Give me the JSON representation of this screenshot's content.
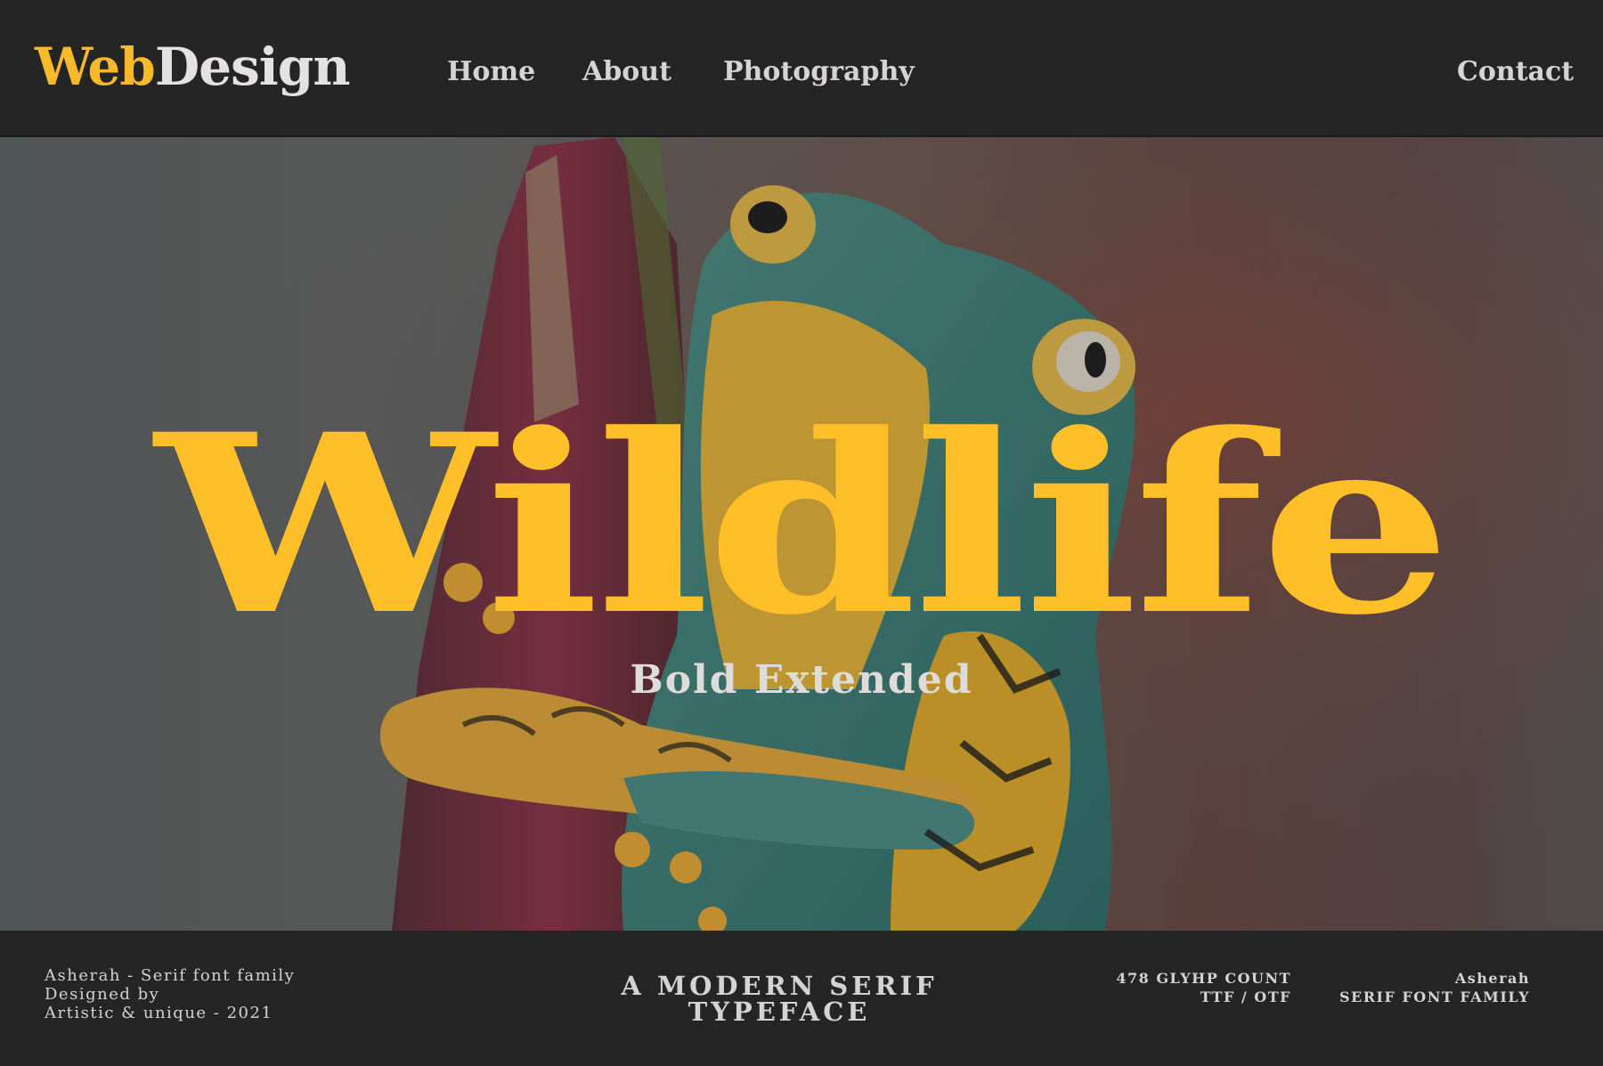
{
  "header": {
    "logo": {
      "part1": "Web",
      "part2": "Design"
    },
    "nav": {
      "home": "Home",
      "about": "About",
      "photography": "Photography",
      "contact": "Contact"
    }
  },
  "hero": {
    "title": "Wildlife",
    "subtitle": "Bold Extended",
    "background": "frog-on-flower-photo"
  },
  "footer": {
    "credits": {
      "line1": "Asherah - Serif font family",
      "line2": "Designed by",
      "line3": "Artistic & unique - 2021"
    },
    "tagline": "A MODERN SERIF TYPEFACE",
    "specs": {
      "glyphs": "478 GLYHP COUNT",
      "formats": "TTF / OTF"
    },
    "family": {
      "name": "Asherah",
      "type": "SERIF FONT FAMILY"
    }
  },
  "colors": {
    "accent": "#ffbf28",
    "background": "#262526",
    "text": "#d6d3d3"
  }
}
